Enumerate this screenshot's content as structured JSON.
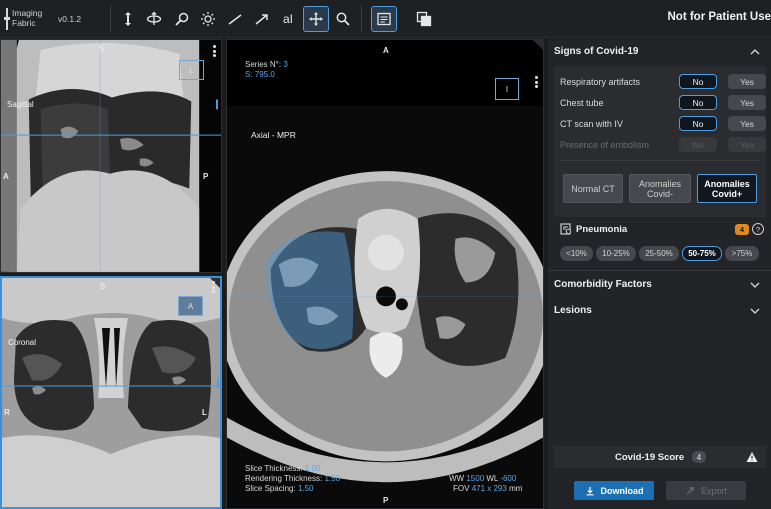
{
  "app": {
    "name": "Imaging Fabric",
    "version": "v0.1.2",
    "notice": "Not for Patient Use"
  },
  "toolbar": {
    "icons": [
      "scroll-vertical-icon",
      "rotate-3d-icon",
      "zoom-icon",
      "brightness-icon",
      "line-measure-icon",
      "arrow-annotation-icon",
      "text-annotation-icon",
      "pan-icon",
      "magnify-icon",
      "report-icon",
      "layers-icon"
    ],
    "text_tool_label": "aI",
    "active_tool": "pan-icon"
  },
  "viewports": {
    "sagittal": {
      "label": "Sagittal",
      "orient_top": "S",
      "orient_left": "A",
      "orient_right": "P",
      "orient_box": "L"
    },
    "coronal": {
      "label": "Coronal",
      "orient_top": "S",
      "orient_left": "R",
      "orient_right": "L",
      "orient_box": "A"
    },
    "axial": {
      "series_label": "Series N°:",
      "series_value": "3",
      "s_label": "S:",
      "s_value": "795.0",
      "view_label": "Axial - MPR",
      "orient_top": "A",
      "orient_bottom": "P",
      "orient_box": "I",
      "slice_thickness_label": "Slice Thickness:",
      "slice_thickness_value": "1.50",
      "rendering_thickness_label": "Rendering Thickness:",
      "rendering_thickness_value": "1.50",
      "slice_spacing_label": "Slice Spacing:",
      "slice_spacing_value": "1.50",
      "ww_label": "WW",
      "ww_value": "1500",
      "wl_label": "WL",
      "wl_value": "-600",
      "fov_label": "FOV",
      "fov_value": "471 x 293",
      "fov_unit": "mm"
    }
  },
  "panel": {
    "signs_title": "Signs of Covid-19",
    "questions": [
      {
        "label": "Respiratory artifacts",
        "no": "No",
        "yes": "Yes",
        "selected": "no",
        "disabled": false
      },
      {
        "label": "Chest tube",
        "no": "No",
        "yes": "Yes",
        "selected": "no",
        "disabled": false
      },
      {
        "label": "CT scan with IV",
        "no": "No",
        "yes": "Yes",
        "selected": "no",
        "disabled": false
      },
      {
        "label": "Presence of embolism",
        "no": "No",
        "yes": "Yes",
        "selected": null,
        "disabled": true
      }
    ],
    "classification": [
      {
        "label": "Normal CT",
        "selected": false
      },
      {
        "label": "Anomalies Covid-",
        "selected": false
      },
      {
        "label": "Anomalies Covid+",
        "selected": true
      }
    ],
    "pneumonia": {
      "title": "Pneumonia",
      "badge": "4",
      "help": "?",
      "options": [
        "<10%",
        "10-25%",
        "25-50%",
        "50-75%",
        ">75%"
      ],
      "selected": "50-75%"
    },
    "comorbidity_title": "Comorbidity Factors",
    "lesions_title": "Lesions",
    "score_label": "Covid-19 Score",
    "score_value": "4",
    "download_label": "Download",
    "export_label": "Export"
  },
  "colors": {
    "accent": "#4d9de0",
    "badge_orange": "#e08a1e",
    "download_blue": "#1c6fb3"
  }
}
